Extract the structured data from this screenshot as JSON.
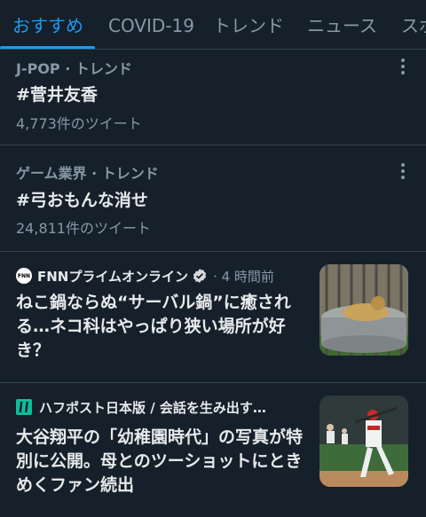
{
  "tabs": [
    {
      "label": "おすすめ"
    },
    {
      "label": "COVID-19"
    },
    {
      "label": "トレンド"
    },
    {
      "label": "ニュース"
    },
    {
      "label": "スポ"
    }
  ],
  "trends": [
    {
      "meta": "J-POP · トレンド",
      "title": "#菅井友香",
      "count": "4,773件のツイート"
    },
    {
      "meta": "ゲーム業界 · トレンド",
      "title": "#弓おもんな消せ",
      "count": "24,811件のツイート"
    }
  ],
  "news": [
    {
      "source": "FNNプライムオンライン",
      "time": "· 4 時間前",
      "logo_text": "FNN",
      "headline": "ねこ鍋ならぬ“サーバル鍋”に癒される…ネコ科はやっぱり狭い場所が好き？"
    },
    {
      "source": "ハフポスト日本版 / 会話を生み出す…",
      "time": "",
      "headline": "大谷翔平の「幼稚園時代」の写真が特別に公開。母とのツーショットにときめくファン続出"
    }
  ],
  "colors": {
    "background": "#15202b",
    "accent": "#1d9bf0",
    "divider": "#38444d",
    "secondary_text": "#8899a6",
    "primary_text": "#e7e9ea"
  },
  "icons": {
    "more": "more-vertical-icon",
    "verified": "verified-badge-icon",
    "huffpost_logo": "huffpost-logo-icon"
  }
}
